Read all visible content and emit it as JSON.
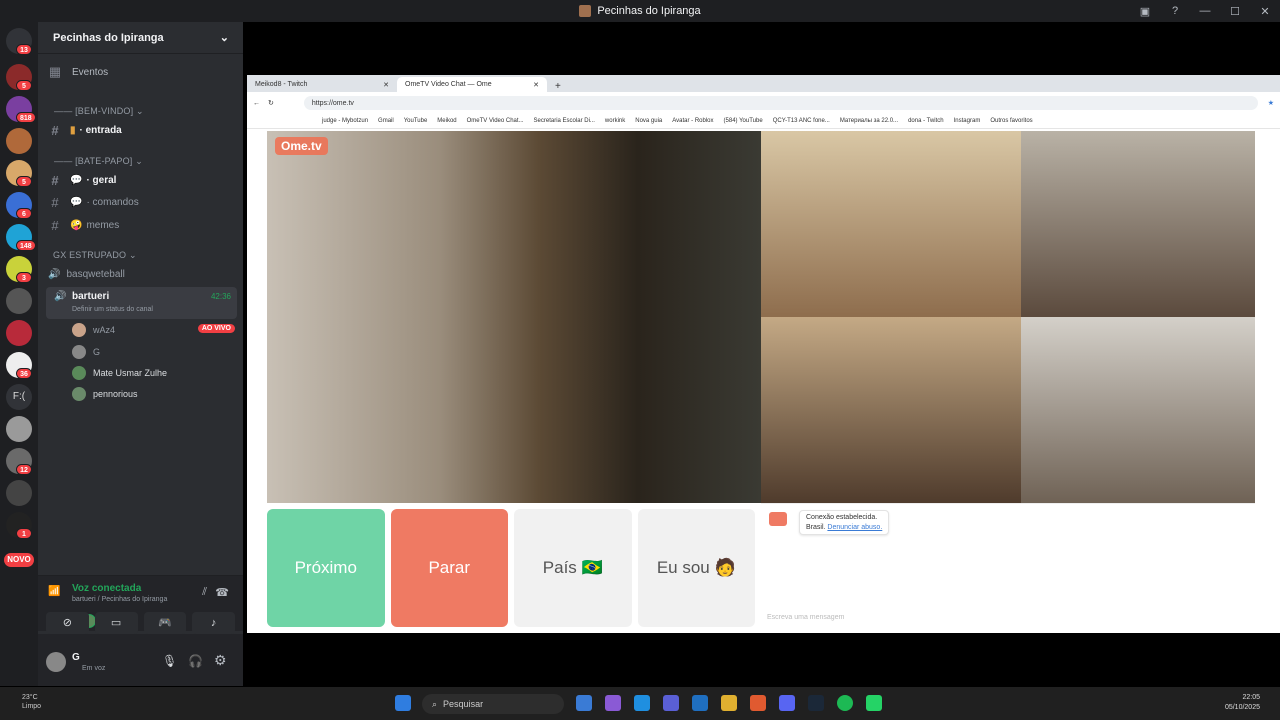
{
  "window": {
    "title": "Pecinhas do Ipiranga"
  },
  "sidebar": {
    "guild_name": "Pecinhas do Ipiranga",
    "events_label": "Eventos",
    "categories": {
      "bemvindo": "[BEM-VINDO]",
      "batepapo": "[BATE-PAPO]",
      "gx": "GX ESTRUPADO"
    },
    "channels": {
      "entrada": "· entrada",
      "geral": "· geral",
      "comandos": "· comandos",
      "memes": "memes",
      "basquete": "basqweteball",
      "bartueri": "bartueri",
      "bartueri_status": "Definir um status do canal",
      "bartueri_time": "42:36"
    },
    "voice_users": [
      "wAz4",
      "G",
      "Mate Usmar Zulhe",
      "pennorious"
    ],
    "live_label": "AO VIVO",
    "server_badges": [
      "13",
      "5",
      "818",
      "5",
      "6",
      "148",
      "3",
      "36",
      "12",
      "1"
    ],
    "novo_label": "NOVO",
    "text_server": "F:(",
    "voice_connected": "Voz conectada",
    "voice_location": "bartueri / Pecinhas do Ipiranga",
    "user_name": "G",
    "user_status": "Em voz"
  },
  "browser": {
    "tabs": [
      "Meikod8 - Twitch",
      "OmeTV Video Chat — Ome"
    ],
    "url": "https://ome.tv",
    "bookmarks": [
      "judge - Mybotzun",
      "Gmail",
      "YouTube",
      "Meikod",
      "OmeTV Video Chat...",
      "Secretaria Escolar Di...",
      "workink",
      "Nova guia",
      "Avatar - Roblox",
      "(584) YouTube",
      "QCY-T13 ANC fone...",
      "Материалы за 22.0...",
      "dona - Twitch",
      "Instagram",
      "Outros favoritos"
    ]
  },
  "ometv": {
    "logo": "Ome.tv",
    "buttons": {
      "next": "Próximo",
      "stop": "Parar",
      "country": "País 🇧🇷",
      "gender": "Eu sou 🧑"
    },
    "chat_status": "Conexão estabelecida.",
    "chat_country": "Brasil.",
    "chat_report": "Denunciar abuso.",
    "chat_placeholder": "Escreva uma mensagem"
  },
  "taskbar": {
    "weather_temp": "23°C",
    "weather_desc": "Limpo",
    "search_placeholder": "Pesquisar",
    "time": "22:05",
    "date": "05/10/2025"
  }
}
